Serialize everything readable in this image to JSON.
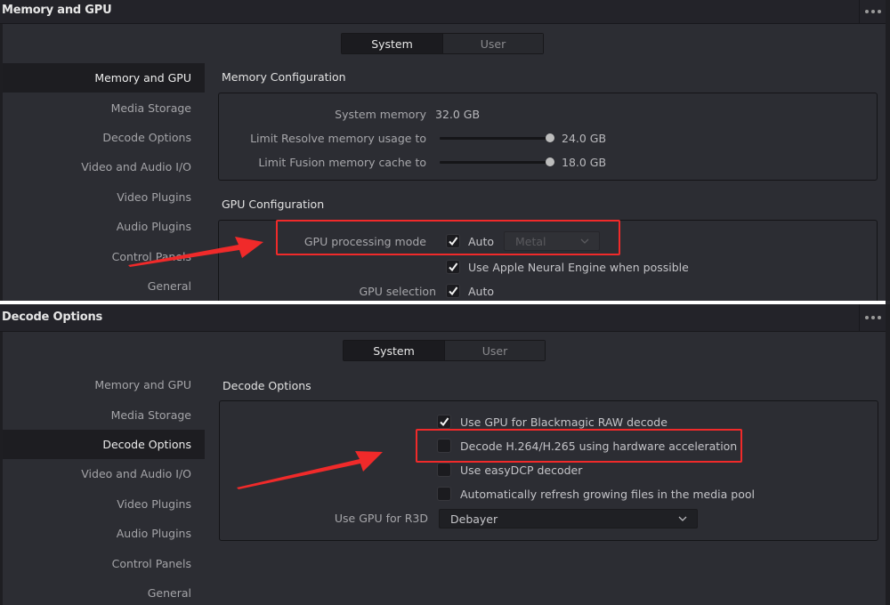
{
  "top_panel": {
    "title": "Memory and GPU",
    "tabs": [
      {
        "label": "System",
        "active": true
      },
      {
        "label": "User",
        "active": false
      }
    ],
    "sidebar": [
      {
        "label": "Memory and GPU",
        "active": true
      },
      {
        "label": "Media Storage",
        "active": false
      },
      {
        "label": "Decode Options",
        "active": false
      },
      {
        "label": "Video and Audio I/O",
        "active": false
      },
      {
        "label": "Video Plugins",
        "active": false
      },
      {
        "label": "Audio Plugins",
        "active": false
      },
      {
        "label": "Control Panels",
        "active": false
      },
      {
        "label": "General",
        "active": false
      }
    ],
    "memory_section": {
      "title": "Memory Configuration",
      "system_memory_label": "System memory",
      "system_memory_value": "32.0 GB",
      "resolve_limit_label": "Limit Resolve memory usage to",
      "resolve_limit_value": "24.0 GB",
      "resolve_limit_fraction": 0.75,
      "fusion_limit_label": "Limit Fusion memory cache to",
      "fusion_limit_value": "18.0 GB",
      "fusion_limit_fraction": 0.75
    },
    "gpu_section": {
      "title": "GPU Configuration",
      "processing_mode_label": "GPU processing mode",
      "processing_mode_auto_label": "Auto",
      "processing_mode_auto_checked": true,
      "processing_mode_value": "Metal",
      "neural_engine_label": "Use Apple Neural Engine when possible",
      "neural_engine_checked": true,
      "gpu_selection_label": "GPU selection",
      "gpu_selection_auto_label": "Auto",
      "gpu_selection_auto_checked": true
    }
  },
  "bottom_panel": {
    "title": "Decode Options",
    "tabs": [
      {
        "label": "System",
        "active": true
      },
      {
        "label": "User",
        "active": false
      }
    ],
    "sidebar": [
      {
        "label": "Memory and GPU",
        "active": false
      },
      {
        "label": "Media Storage",
        "active": false
      },
      {
        "label": "Decode Options",
        "active": true
      },
      {
        "label": "Video and Audio I/O",
        "active": false
      },
      {
        "label": "Video Plugins",
        "active": false
      },
      {
        "label": "Audio Plugins",
        "active": false
      },
      {
        "label": "Control Panels",
        "active": false
      },
      {
        "label": "General",
        "active": false
      }
    ],
    "decode_section": {
      "title": "Decode Options",
      "options": [
        {
          "label": "Use GPU for Blackmagic RAW decode",
          "checked": true
        },
        {
          "label": "Decode H.264/H.265 using hardware acceleration",
          "checked": false
        },
        {
          "label": "Use easyDCP decoder",
          "checked": false
        },
        {
          "label": "Automatically refresh growing files in the media pool",
          "checked": false
        }
      ],
      "r3d_label": "Use GPU for R3D",
      "r3d_value": "Debayer"
    }
  },
  "annotations": {
    "highlight_color": "#f02a2a"
  }
}
